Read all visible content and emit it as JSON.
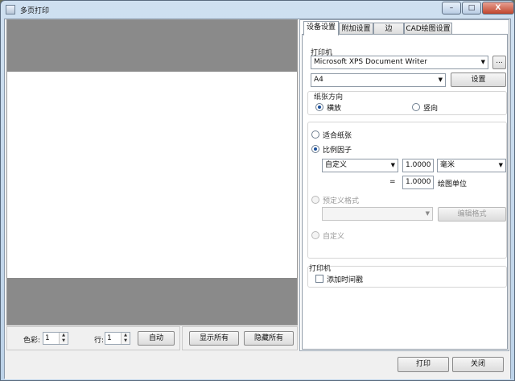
{
  "window": {
    "title": "多页打印",
    "minimize": "–",
    "maximize": "□",
    "close": "X"
  },
  "bottom_left": {
    "color_label": "色彩:",
    "color_value": "1",
    "row_label": "行:",
    "row_value": "1",
    "auto_button": "自动"
  },
  "bottom_mid": {
    "show_all": "显示所有",
    "hide_all": "隐藏所有"
  },
  "tabs": [
    "设备设置",
    "附加设置",
    "边",
    "CAD绘图设置"
  ],
  "printer_group": {
    "title": "打印机",
    "printer_value": "Microsoft XPS Document Writer",
    "browse_label": "...",
    "paper_value": "A4",
    "setup_button": "设置"
  },
  "orientation": {
    "title": "纸张方向",
    "landscape": "横放",
    "portrait": "竖向",
    "selected": "landscape"
  },
  "scale": {
    "fit_paper": "适合纸张",
    "scale_factor": "比例因子",
    "selected": "scale_factor",
    "mode_value": "自定义",
    "factor_value": "1.0000",
    "unit_value": "毫米",
    "equals": "=",
    "drawing_value": "1.0000",
    "drawing_units": "绘图单位",
    "predefined": "预定义格式",
    "predefined_value": "",
    "edit_format": "编辑格式",
    "custom": "自定义"
  },
  "printer_stamp": {
    "title": "打印机",
    "add_timestamp": "添加时间戳",
    "checked": false
  },
  "footer": {
    "print": "打印",
    "close": "关闭"
  }
}
